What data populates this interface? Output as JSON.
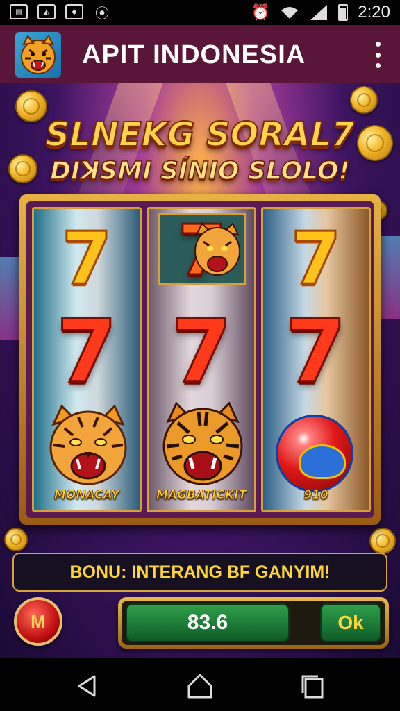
{
  "status_bar": {
    "time": "2:20",
    "left_icons": [
      "sim-icon",
      "image-icon",
      "shield-icon",
      "location-icon"
    ],
    "right_icons": [
      "alarm-icon",
      "wifi-icon",
      "signal-icon",
      "battery-icon"
    ]
  },
  "app_bar": {
    "title": "APIT INDONESIA",
    "logo_icon": "tiger-logo-icon",
    "menu_icon": "more-vert-icon"
  },
  "headline": {
    "line1": "SLNEKG SORAL7",
    "line2": "DIꓘSMI SÍNIO SLOLO!"
  },
  "reels": [
    {
      "symbols": [
        "seven",
        "seven",
        "tiger"
      ],
      "label": "MONACAY"
    },
    {
      "symbols": [
        "tiger-seven",
        "seven",
        "tiger"
      ],
      "label": "MAGBATICKIT"
    },
    {
      "symbols": [
        "seven",
        "seven",
        "ball"
      ],
      "label": "910"
    }
  ],
  "bonus": {
    "text": "BONU: INTERANG BF GANYIM!"
  },
  "controls": {
    "m_button_label": "M",
    "amount": "83.6",
    "ok_label": "Ok"
  },
  "nav_bar": {
    "icons": [
      "back-icon",
      "home-icon",
      "recents-icon"
    ]
  },
  "colors": {
    "app_bar_bg": "#5a1638",
    "accent_gold": "#d7a43c",
    "seven_red": "#ff3a1a",
    "seven_yellow": "#ffc21a",
    "amount_green": "#1f7a38"
  }
}
